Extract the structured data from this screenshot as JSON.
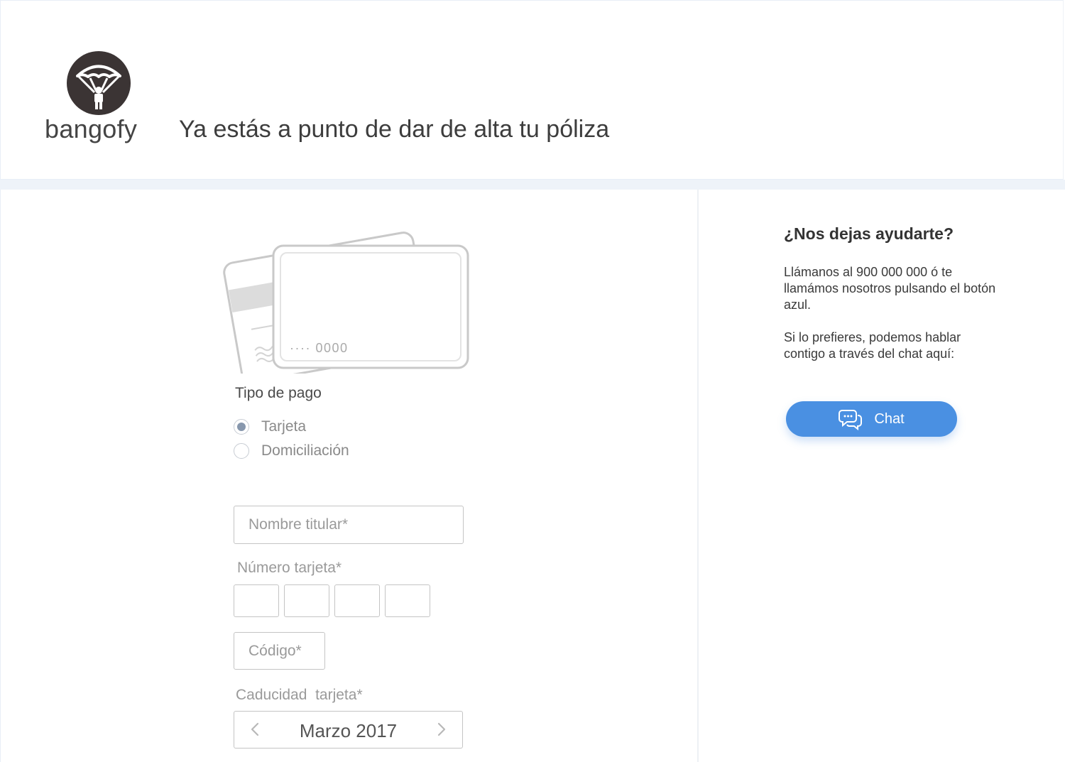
{
  "brand": {
    "name": "bangofy"
  },
  "header": {
    "title": "Ya estás a punto de dar de alta tu póliza"
  },
  "card_illustration": {
    "masked_number": "···· 0000"
  },
  "payment": {
    "section_label": "Tipo de pago",
    "options": [
      {
        "label": "Tarjeta",
        "selected": true
      },
      {
        "label": "Domiciliación",
        "selected": false
      }
    ]
  },
  "form": {
    "holder_name_placeholder": "Nombre titular*",
    "card_number_label": "Número tarjeta*",
    "card_number_groups": [
      "",
      "",
      "",
      ""
    ],
    "cvv_placeholder": "Código*",
    "expiry_label": "Caducidad  tarjeta*",
    "expiry_value": "Marzo 2017"
  },
  "help": {
    "title": "¿Nos dejas ayudarte?",
    "paragraph1": "Llámanos al 900 000 000 ó te llamámos nosotros pulsando el botón azul.",
    "paragraph2": "Si lo prefieres, podemos hablar contigo a través del chat aquí:",
    "chat_button_label": "Chat",
    "chat_button_color": "#4a90e2"
  },
  "icons": {
    "logo": "parachute-logo-icon",
    "chat": "chat-bubbles-icon",
    "prev": "chevron-left-icon",
    "next": "chevron-right-icon"
  }
}
